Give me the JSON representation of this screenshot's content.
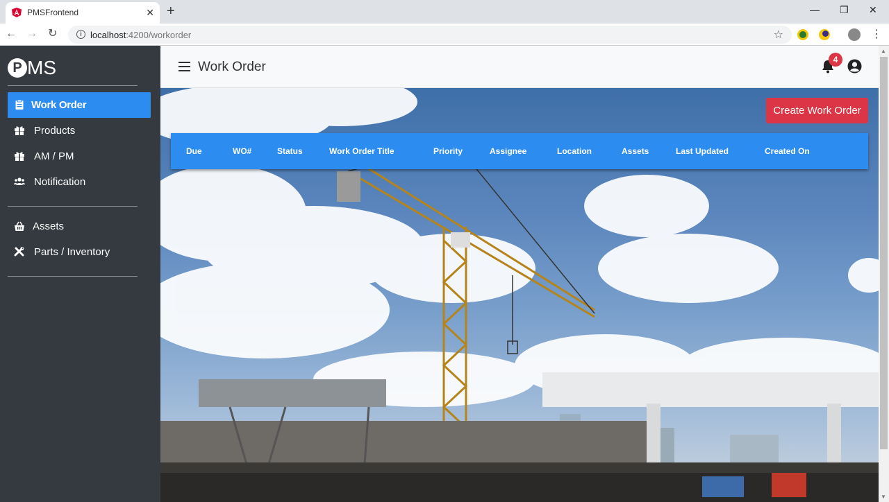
{
  "browser": {
    "tab_title": "PMSFrontend",
    "new_tab": "+",
    "url_host": "localhost",
    "url_path": ":4200/workorder"
  },
  "sidebar": {
    "logo_letter": "P",
    "logo_text": "MS",
    "items": [
      {
        "label": "Work Order",
        "icon": "clipboard-icon",
        "active": true
      },
      {
        "label": "Products",
        "icon": "gift-icon"
      },
      {
        "label": "AM / PM",
        "icon": "gift-icon"
      },
      {
        "label": "Notification",
        "icon": "users-icon"
      },
      {
        "label": "Assets",
        "icon": "basket-icon"
      },
      {
        "label": "Parts / Inventory",
        "icon": "tools-icon"
      }
    ]
  },
  "header": {
    "title": "Work Order",
    "notification_count": "4"
  },
  "actions": {
    "create_label": "Create Work Order"
  },
  "table": {
    "columns": [
      "Due",
      "WO#",
      "Status",
      "Work Order Title",
      "Priority",
      "Assignee",
      "Location",
      "Assets",
      "Last Updated",
      "Created On"
    ]
  },
  "colors": {
    "sidebar_bg": "#343a40",
    "accent": "#2d8cf0",
    "danger": "#dc3545"
  }
}
